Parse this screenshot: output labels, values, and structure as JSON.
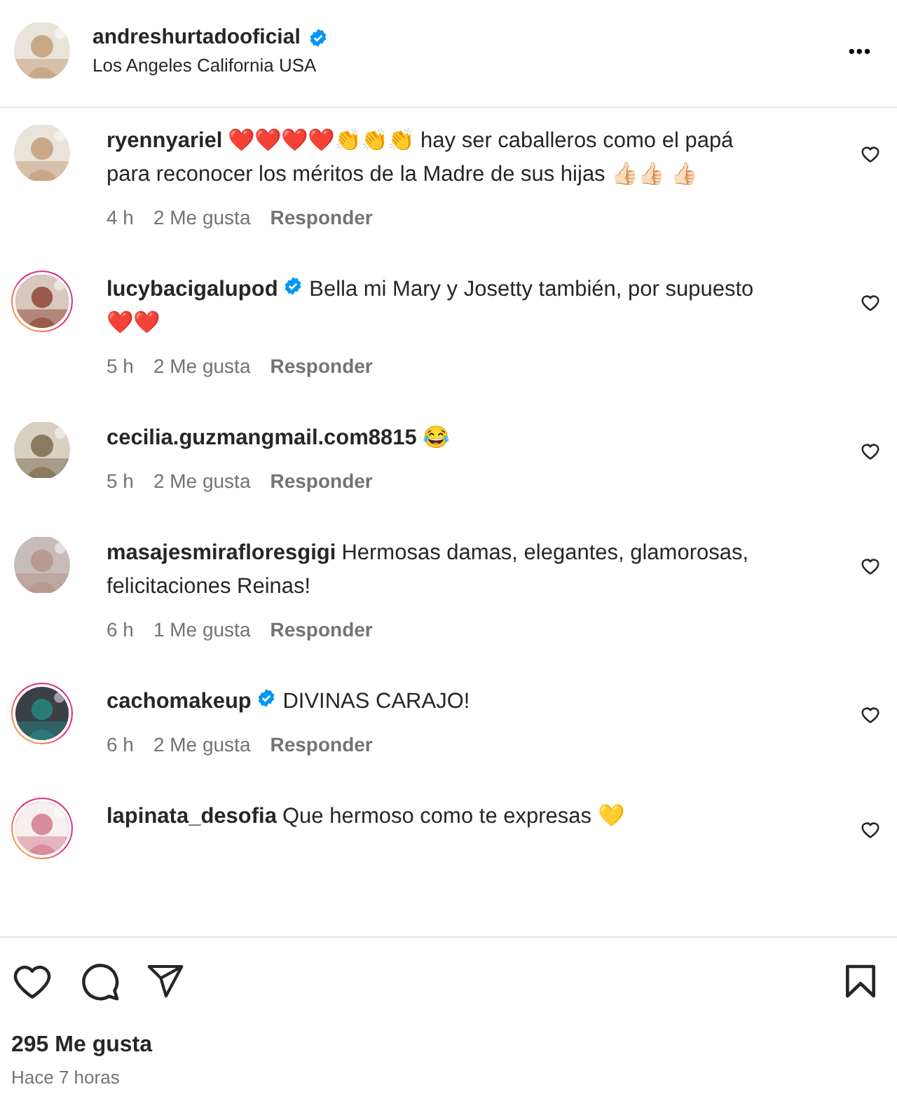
{
  "post_header": {
    "username": "andreshurtadooficial",
    "verified": true,
    "location": "Los Angeles California USA",
    "more": "•••"
  },
  "comments": [
    {
      "username": "ryennyariel",
      "verified": false,
      "story_ring": false,
      "text": "❤️❤️❤️❤️👏👏👏 hay ser caballeros como el papá para reconocer los méritos de la Madre de sus hijas 👍🏻👍🏻 👍🏻",
      "time": "4 h",
      "likes": "2 Me gusta",
      "reply": "Responder"
    },
    {
      "username": "lucybacigalupod",
      "verified": true,
      "story_ring": true,
      "text": "Bella mi Mary y Josetty también, por supuesto ❤️❤️",
      "time": "5 h",
      "likes": "2 Me gusta",
      "reply": "Responder"
    },
    {
      "username": "cecilia.guzmangmail.com8815",
      "verified": false,
      "story_ring": false,
      "text": "😂",
      "time": "5 h",
      "likes": "2 Me gusta",
      "reply": "Responder"
    },
    {
      "username": "masajesmirafloresgigi",
      "verified": false,
      "story_ring": false,
      "text": "Hermosas damas, elegantes, glamorosas, felicitaciones Reinas!",
      "time": "6 h",
      "likes": "1 Me gusta",
      "reply": "Responder"
    },
    {
      "username": "cachomakeup",
      "verified": true,
      "story_ring": true,
      "text": "DIVINAS CARAJO!",
      "time": "6 h",
      "likes": "2 Me gusta",
      "reply": "Responder"
    },
    {
      "username": "lapinata_desofia",
      "verified": false,
      "story_ring": true,
      "text": "Que hermoso como te expresas 💛"
    }
  ],
  "footer": {
    "likes": "295 Me gusta",
    "posted": "Hace 7 horas"
  }
}
